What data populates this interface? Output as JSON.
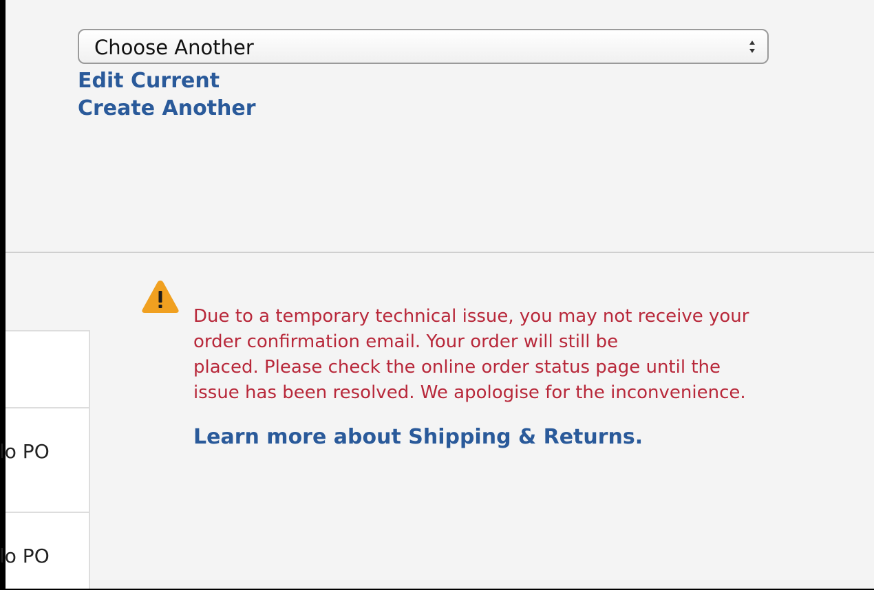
{
  "selector": {
    "value": "Choose Another"
  },
  "links": {
    "edit_current": "Edit Current",
    "create_another": "Create Another"
  },
  "notice": {
    "icon": "warning-icon",
    "lines": [
      "Due to a temporary technical issue, you may not receive your",
      "order confirmation email. Your order will still be",
      "placed. Please check the online order status page until the",
      "issue has been resolved. We apologise for the inconvenience."
    ],
    "learn_more": "Learn more about Shipping & Returns."
  },
  "side_table": {
    "rows": [
      "lo PO",
      "lo PO"
    ]
  },
  "colors": {
    "link": "#2a5a9a",
    "notice_text": "#b8283a",
    "warning": "#f0a020"
  }
}
